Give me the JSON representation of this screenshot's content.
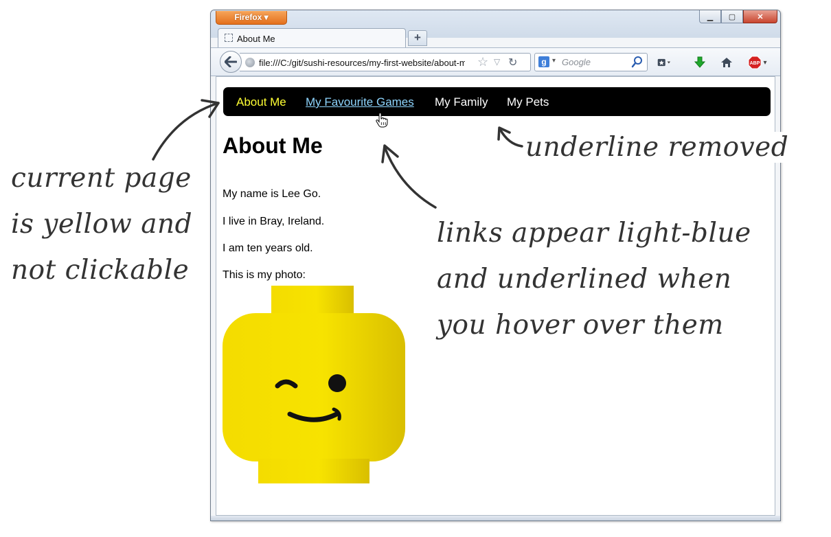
{
  "browser": {
    "app_menu_label": "Firefox",
    "window_controls": {
      "minimize_icon": "minimize-icon",
      "maximize_icon": "maximize-icon",
      "close_icon": "close-icon"
    },
    "tab": {
      "title": "About Me",
      "favicon": "page-icon"
    },
    "new_tab_label": "+",
    "url": "file:///C:/git/sushi-resources/my-first-website/about-me.html",
    "search_placeholder": "Google",
    "toolbar_icons": [
      "bookmarks-icon",
      "download-icon",
      "home-icon",
      "adblock-icon"
    ],
    "adblock_label": "ABP"
  },
  "page": {
    "nav": [
      {
        "label": "About Me",
        "state": "current",
        "color": "#ffff33"
      },
      {
        "label": "My Favourite Games",
        "state": "hover",
        "color": "#8fd6ff"
      },
      {
        "label": "My Family",
        "state": "normal",
        "color": "#ffffff"
      },
      {
        "label": "My Pets",
        "state": "normal",
        "color": "#ffffff"
      }
    ],
    "title": "About Me",
    "paragraphs": [
      "My name is Lee Go.",
      "I live in Bray, Ireland.",
      "I am ten years old.",
      "This is my photo:"
    ],
    "photo": "lego-head-winking"
  },
  "annotations": {
    "current_page": "current page is yellow and not clickable",
    "underline_removed": "underline removed",
    "links_hover": "links appear light-blue and underlined when you hover over them"
  }
}
